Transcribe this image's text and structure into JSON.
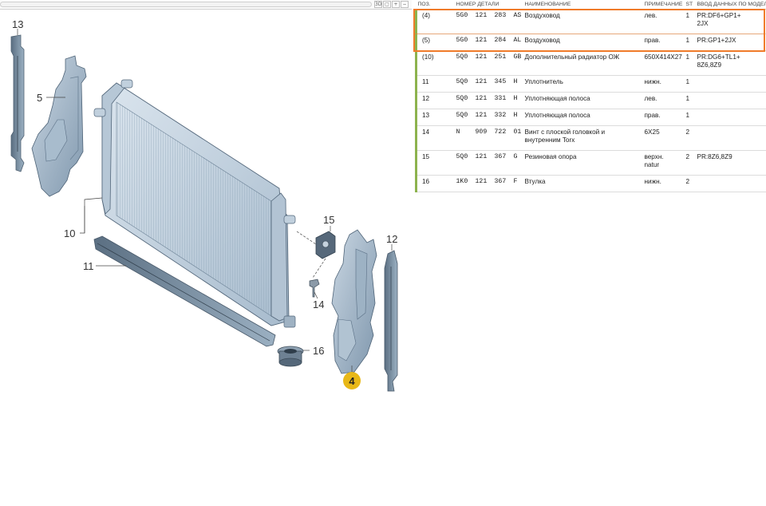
{
  "parts_table": {
    "headers": {
      "pos": "ПОЗ.",
      "part_number": "НОМЕР ДЕТАЛИ",
      "name": "НАИМЕНОВАНИЕ",
      "note": "ПРИМЕЧАНИЕ",
      "qty": "ST",
      "model_data": "ВВОД ДАННЫХ ПО МОДЕЛИ"
    },
    "rows": [
      {
        "pos": "(4)",
        "p1": "5G0",
        "p2": "121",
        "p3": "283",
        "p4": "AS",
        "name": "Воздуховод",
        "note": "лев.",
        "qty": "1",
        "model": "PR:DF6+GP1+\n2JX",
        "highlighted": true
      },
      {
        "pos": "(5)",
        "p1": "5G0",
        "p2": "121",
        "p3": "284",
        "p4": "AL",
        "name": "Воздуховод",
        "note": "прав.",
        "qty": "1",
        "model": "PR:GP1+2JX",
        "highlighted": true
      },
      {
        "pos": "(10)",
        "p1": "5Q0",
        "p2": "121",
        "p3": "251",
        "p4": "GB",
        "name": "Дополнительный радиатор ОЖ",
        "note": "650X414X27",
        "qty": "1",
        "model": "PR:DG6+TL1+\n8Z6,8Z9",
        "highlighted": false
      },
      {
        "pos": "11",
        "p1": "5Q0",
        "p2": "121",
        "p3": "345",
        "p4": "H",
        "name": "Уплотнитель",
        "note": "нижн.",
        "qty": "1",
        "model": "",
        "highlighted": false
      },
      {
        "pos": "12",
        "p1": "5Q0",
        "p2": "121",
        "p3": "331",
        "p4": "H",
        "name": "Уплотняющая полоса",
        "note": "лев.",
        "qty": "1",
        "model": "",
        "highlighted": false
      },
      {
        "pos": "13",
        "p1": "5Q0",
        "p2": "121",
        "p3": "332",
        "p4": "H",
        "name": "Уплотняющая полоса",
        "note": "прав.",
        "qty": "1",
        "model": "",
        "highlighted": false
      },
      {
        "pos": "14",
        "p1": "N",
        "p2": "909",
        "p3": "722",
        "p4": "01",
        "name": "Винт с плоской головкой и\nвнутренним Torx",
        "note": "6X25",
        "qty": "2",
        "model": "",
        "highlighted": false
      },
      {
        "pos": "15",
        "p1": "5Q0",
        "p2": "121",
        "p3": "367",
        "p4": "G",
        "name": "Резиновая опора",
        "note": "верхн.\nnatur",
        "qty": "2",
        "model": "PR:8Z6,8Z9",
        "highlighted": false
      },
      {
        "pos": "16",
        "p1": "1K0",
        "p2": "121",
        "p3": "367",
        "p4": "F",
        "name": "Втулка",
        "note": "нижн.",
        "qty": "2",
        "model": "",
        "highlighted": false
      }
    ]
  },
  "diagram": {
    "callouts": {
      "c13": "13",
      "c5": "5",
      "c10": "10",
      "c11": "11",
      "c15": "15",
      "c14": "14",
      "c16": "16",
      "c4": "4",
      "c12": "12"
    },
    "highlight_color": "#f07b2a",
    "selected_badge_color": "#e8b818",
    "toolbar_icons": [
      "3d-icon",
      "box-icon",
      "zoom-in-icon",
      "zoom-out-icon",
      "move-icon"
    ]
  }
}
